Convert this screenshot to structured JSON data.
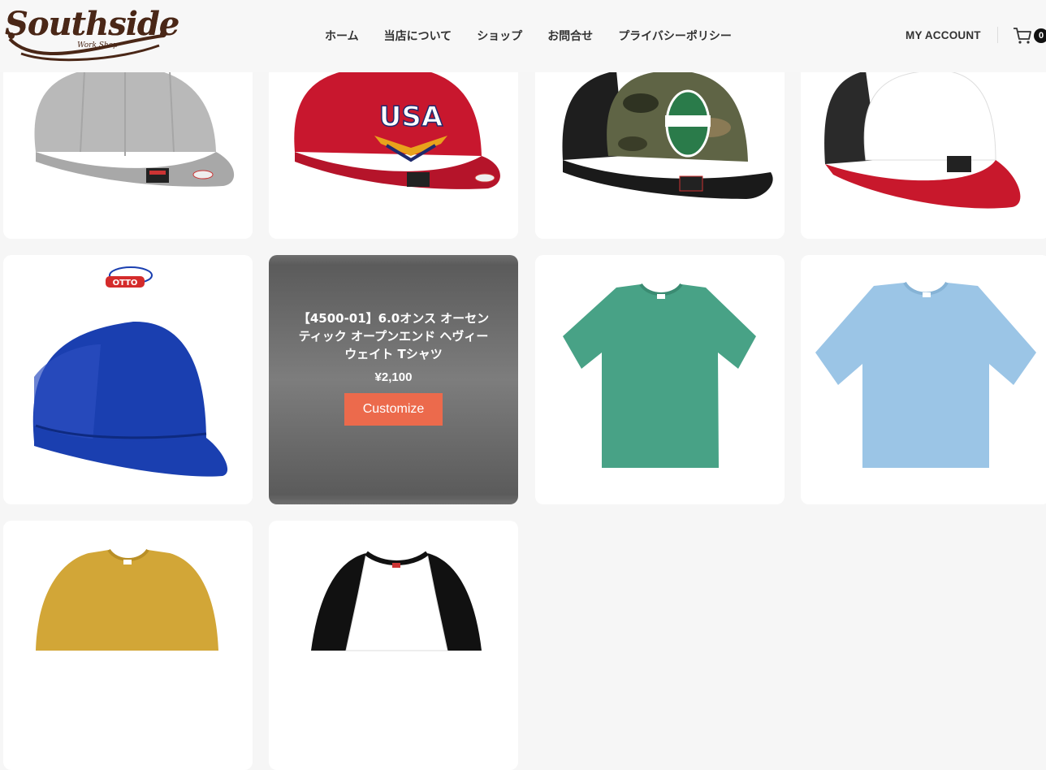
{
  "header": {
    "logo": {
      "title": "Southside",
      "subtitle": "Work Shop"
    },
    "nav": [
      "ホーム",
      "当店について",
      "ショップ",
      "お問合せ",
      "プライバシーポリシー"
    ],
    "account_label": "MY ACCOUNT",
    "cart_count": "0"
  },
  "products": [
    {
      "kind": "cap",
      "colors": {
        "crown": "#b9b9b9",
        "brim": "#a9a9a9"
      },
      "image": "heather-gray-snapback-icon"
    },
    {
      "kind": "cap",
      "colors": {
        "crown": "#c8172e",
        "brim": "#b5142a"
      },
      "badge": "USA",
      "image": "red-usa-cap-icon"
    },
    {
      "kind": "cap",
      "colors": {
        "crown": "#5f6445",
        "brim": "#1a1a1a"
      },
      "image": "camo-trucker-cap-icon"
    },
    {
      "kind": "cap",
      "colors": {
        "crown": "#ffffff",
        "brim": "#c8182c"
      },
      "image": "white-red-trucker-cap-icon"
    },
    {
      "kind": "cap",
      "colors": {
        "crown": "#1a3fb0",
        "brim": "#1a3fb0"
      },
      "brand": "OTTO",
      "image": "blue-mesh-cap-icon"
    },
    {
      "kind": "overlay",
      "title": "【4500-01】6.0オンス オーセンティック オープンエンド ヘヴィーウェイト Tシャツ",
      "price": "¥2,100",
      "button": "Customize"
    },
    {
      "kind": "tshirt",
      "colors": {
        "body": "#48a286"
      },
      "image": "green-tshirt-icon"
    },
    {
      "kind": "tshirt",
      "colors": {
        "body": "#9bc5e6"
      },
      "image": "light-blue-tshirt-icon"
    },
    {
      "kind": "sweatshirt",
      "colors": {
        "body": "#d2a637"
      },
      "image": "mustard-sweatshirt-icon"
    },
    {
      "kind": "raglan",
      "colors": {
        "body": "#ffffff",
        "sleeve": "#111111"
      },
      "image": "raglan-tee-icon"
    }
  ]
}
